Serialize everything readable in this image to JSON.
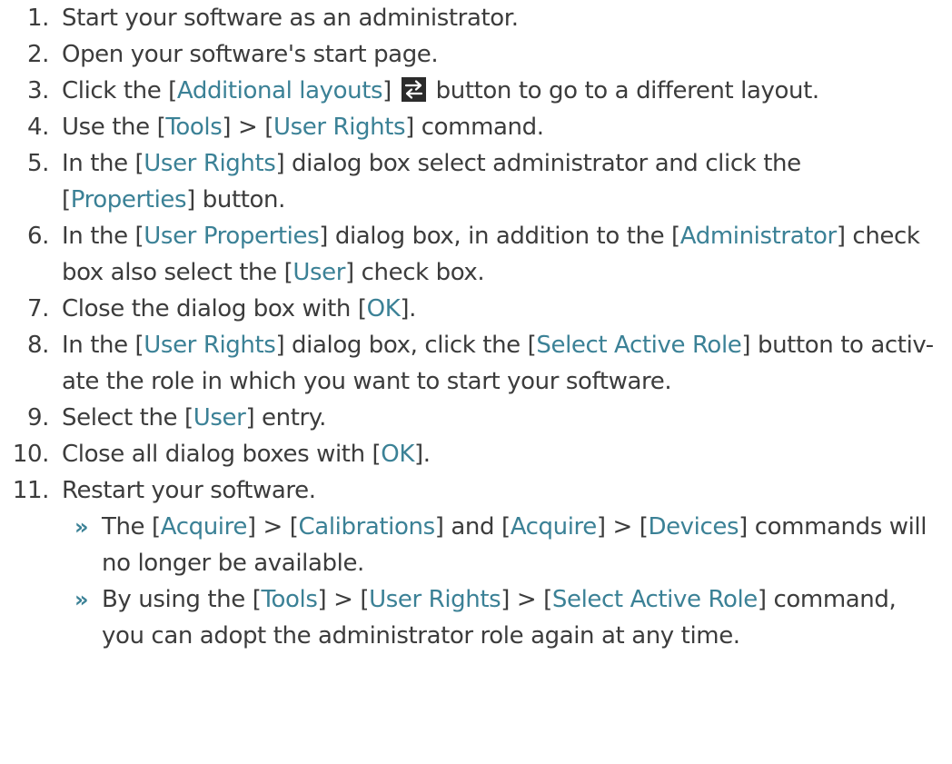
{
  "steps": [
    {
      "num": "1.",
      "lines": [
        [
          {
            "t": "Start your software as an administrator."
          }
        ]
      ]
    },
    {
      "num": "2.",
      "lines": [
        [
          {
            "t": "Open your software's start page."
          }
        ]
      ]
    },
    {
      "num": "3.",
      "lines": [
        [
          {
            "t": "Click the ["
          },
          {
            "t": "Additional layouts",
            "ui": true
          },
          {
            "t": "] "
          },
          {
            "icon": "swap-arrows-icon"
          },
          {
            "t": " button to go to a different layout."
          }
        ]
      ]
    },
    {
      "num": "4.",
      "lines": [
        [
          {
            "t": "Use the ["
          },
          {
            "t": "Tools",
            "ui": true
          },
          {
            "t": "] > ["
          },
          {
            "t": "User Rights",
            "ui": true
          },
          {
            "t": "] command."
          }
        ]
      ]
    },
    {
      "num": "5.",
      "lines": [
        [
          {
            "t": "In the ["
          },
          {
            "t": "User Rights",
            "ui": true
          },
          {
            "t": "] dialog box select administrator and click the"
          }
        ],
        [
          {
            "t": "["
          },
          {
            "t": "Properties",
            "ui": true
          },
          {
            "t": "] button."
          }
        ]
      ]
    },
    {
      "num": "6.",
      "lines": [
        [
          {
            "t": "In the ["
          },
          {
            "t": "User Properties",
            "ui": true
          },
          {
            "t": "] dialog box, in addition to the ["
          },
          {
            "t": "Administrator",
            "ui": true
          },
          {
            "t": "] check"
          }
        ],
        [
          {
            "t": "box also select the ["
          },
          {
            "t": "User",
            "ui": true
          },
          {
            "t": "] check box."
          }
        ]
      ]
    },
    {
      "num": "7.",
      "lines": [
        [
          {
            "t": "Close the dialog box with ["
          },
          {
            "t": "OK",
            "ui": true
          },
          {
            "t": "]."
          }
        ]
      ]
    },
    {
      "num": "8.",
      "lines": [
        [
          {
            "t": "In the ["
          },
          {
            "t": "User Rights",
            "ui": true
          },
          {
            "t": "] dialog box, click the ["
          },
          {
            "t": "Select Active Role",
            "ui": true
          },
          {
            "t": "] button to activ-"
          }
        ],
        [
          {
            "t": "ate the role in which you want to start your software."
          }
        ]
      ]
    },
    {
      "num": "9.",
      "lines": [
        [
          {
            "t": "Select the ["
          },
          {
            "t": "User",
            "ui": true
          },
          {
            "t": "] entry."
          }
        ]
      ]
    },
    {
      "num": "10.",
      "lines": [
        [
          {
            "t": "Close all dialog boxes with ["
          },
          {
            "t": "OK",
            "ui": true
          },
          {
            "t": "]."
          }
        ]
      ]
    },
    {
      "num": "11.",
      "lines": [
        [
          {
            "t": "Restart your software."
          }
        ]
      ]
    }
  ],
  "results_marker": "»",
  "results": [
    {
      "lines": [
        [
          {
            "t": "The ["
          },
          {
            "t": "Acquire",
            "ui": true
          },
          {
            "t": "] > ["
          },
          {
            "t": "Calibrations",
            "ui": true
          },
          {
            "t": "] and ["
          },
          {
            "t": "Acquire",
            "ui": true
          },
          {
            "t": "] > ["
          },
          {
            "t": "Devices",
            "ui": true
          },
          {
            "t": "] commands will"
          }
        ],
        [
          {
            "t": "no longer be available."
          }
        ]
      ]
    },
    {
      "lines": [
        [
          {
            "t": "By using the ["
          },
          {
            "t": "Tools",
            "ui": true
          },
          {
            "t": "] > ["
          },
          {
            "t": "User Rights",
            "ui": true
          },
          {
            "t": "] > ["
          },
          {
            "t": "Select Active Role",
            "ui": true
          },
          {
            "t": "] command,"
          }
        ],
        [
          {
            "t": "you can adopt the administrator role again at any time."
          }
        ]
      ]
    }
  ],
  "colors": {
    "text": "#3c3c3c",
    "ui_reference": "#3b8196",
    "icon_bg": "#2b2b2b"
  }
}
